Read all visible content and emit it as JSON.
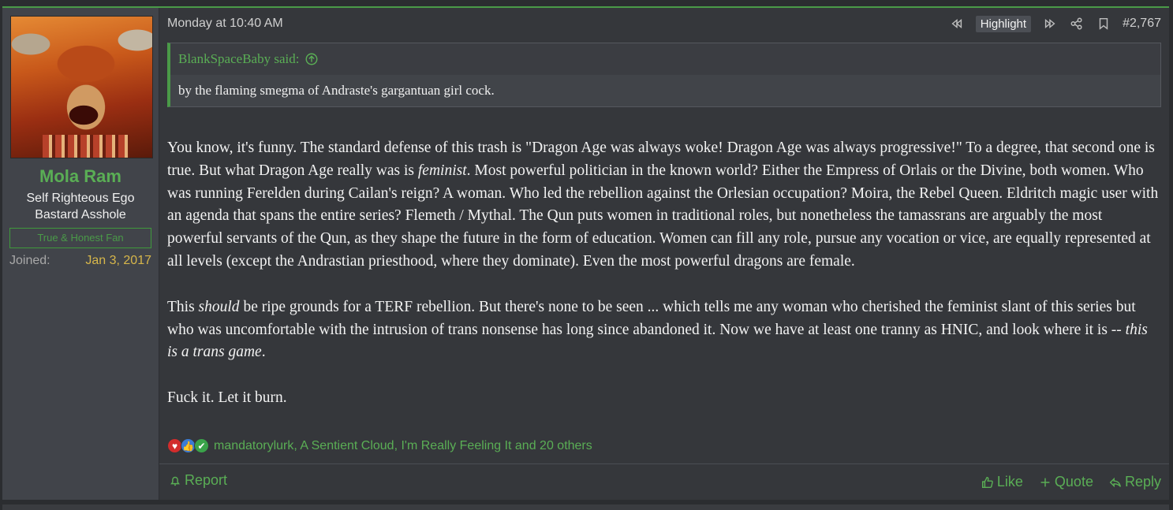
{
  "user": {
    "name": "Mola Ram",
    "title_line1": "Self Righteous Ego",
    "title_line2": "Bastard Asshole",
    "banner": "True & Honest Fan",
    "joined_label": "Joined:",
    "joined_value": "Jan 3, 2017"
  },
  "meta": {
    "date": "Monday at 10:40 AM",
    "highlight_label": "Highlight",
    "post_number": "#2,767"
  },
  "quote": {
    "author": "BlankSpaceBaby said:",
    "text": "by the flaming smegma of Andraste's gargantuan girl cock."
  },
  "body": {
    "p1_a": "You know, it's funny. The standard defense of this trash is \"Dragon Age was always woke! Dragon Age was always progressive!\" To a degree, that second one is true. But what Dragon Age really was is ",
    "p1_em": "feminist",
    "p1_b": ". Most powerful politician in the known world? Either the Empress of Orlais or the Divine, both women. Who was running Ferelden during Cailan's reign? A woman. Who led the rebellion against the Orlesian occupation? Moira, the Rebel Queen. Eldritch magic user with an agenda that spans the entire series? Flemeth / Mythal. The Qun puts women in traditional roles, but nonetheless the tamassrans are arguably the most powerful servants of the Qun, as they shape the future in the form of education. Women can fill any role, pursue any vocation or vice, are equally represented at all levels (except the Andrastian priesthood, where they dominate). Even the most powerful dragons are female.",
    "p2_a": "This ",
    "p2_em": "should",
    "p2_b": " be ripe grounds for a TERF rebellion. But there's none to be seen ... which tells me any woman who cherished the feminist slant of this series but who was uncomfortable with the intrusion of trans nonsense has long since abandoned it. Now we have at least one tranny as HNIC, and look where it is -- ",
    "p2_em2": "this is a trans game",
    "p2_c": ".",
    "p3": "Fuck it. Let it burn."
  },
  "reactions": {
    "icons": [
      "heart-icon",
      "like-icon",
      "agree-icon"
    ],
    "names": "mandatorylurk, A Sentient Cloud, I'm Really Feeling It and 20 others"
  },
  "footer": {
    "report": "Report",
    "like": "Like",
    "quote": "Quote",
    "reply": "Reply"
  },
  "colors": {
    "accent": "#4a9a48",
    "joined_value": "#d6b64a"
  }
}
